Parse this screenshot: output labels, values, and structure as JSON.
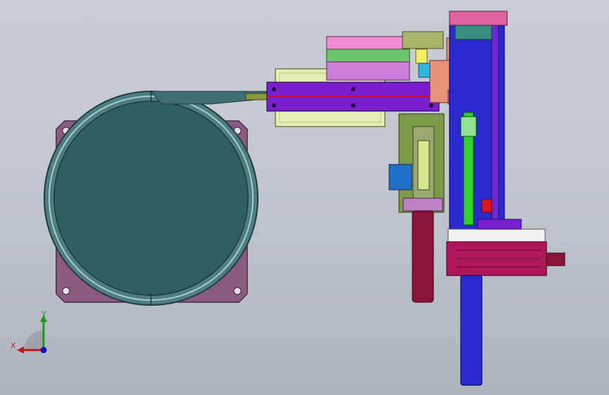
{
  "viewport": {
    "background_top": "#c9cdd3",
    "background_bottom": "#aeb4bc"
  },
  "triad": {
    "y_label": "Y",
    "x_label": "X",
    "y_color": "#1a9a1a",
    "x_color": "#c01818",
    "origin_color": "#1010c0"
  },
  "parts": {
    "base_plate_color": "#8a5a82",
    "disc_color": "#2f5f62",
    "ring_color": "#4d7f82",
    "bar_color": "#7a1fd0",
    "motor_color": "#b0185a",
    "column_color": "#2a2ad0",
    "lift_cylinder_color": "#8a1438",
    "rod_color": "#2fd02f",
    "pink_block_color": "#f28bd0",
    "green_block_color": "#6cc46c",
    "violet_block_color": "#cc7fd6",
    "cream_plate_color": "#e6efb0",
    "olive_plate_color": "#7c9a4a",
    "salmon_color": "#e8907a"
  }
}
